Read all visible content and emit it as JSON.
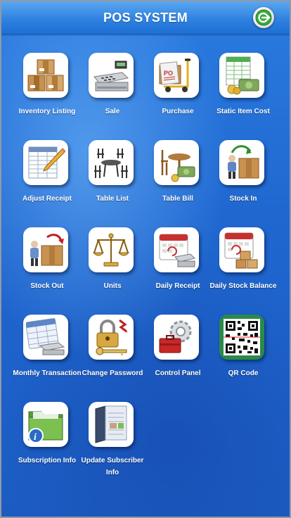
{
  "header": {
    "title": "POS SYSTEM",
    "logout_icon": "logout-arrow-icon"
  },
  "tiles": [
    {
      "label": "Inventory Listing",
      "icon": "boxes-icon"
    },
    {
      "label": "Sale",
      "icon": "cash-register-icon"
    },
    {
      "label": "Purchase",
      "icon": "hand-truck-icon"
    },
    {
      "label": "Static Item Cost",
      "icon": "spreadsheet-money-icon"
    },
    {
      "label": "Adjust Receipt",
      "icon": "table-pencil-icon"
    },
    {
      "label": "Table List",
      "icon": "table-chairs-icon"
    },
    {
      "label": "Table Bill",
      "icon": "table-money-icon"
    },
    {
      "label": "Stock In",
      "icon": "stock-in-icon"
    },
    {
      "label": "Stock Out",
      "icon": "stock-out-icon"
    },
    {
      "label": "Units",
      "icon": "scale-icon"
    },
    {
      "label": "Daily Receipt",
      "icon": "calendar-register-icon"
    },
    {
      "label": "Daily Stock Balance",
      "icon": "calendar-boxes-icon"
    },
    {
      "label": "Monthly Transaction",
      "icon": "calendar-cash-icon"
    },
    {
      "label": "Change Password",
      "icon": "padlock-key-icon"
    },
    {
      "label": "Control Panel",
      "icon": "gear-toolbox-icon"
    },
    {
      "label": "QR Code",
      "icon": "qr-code-icon"
    },
    {
      "label": "Subscription Info",
      "icon": "folder-info-icon"
    },
    {
      "label": "Update Subscriber Info",
      "icon": "book-edit-icon"
    }
  ],
  "colors": {
    "background": "#1e69d2",
    "header": "#2f82e0",
    "label": "#ffffff"
  }
}
